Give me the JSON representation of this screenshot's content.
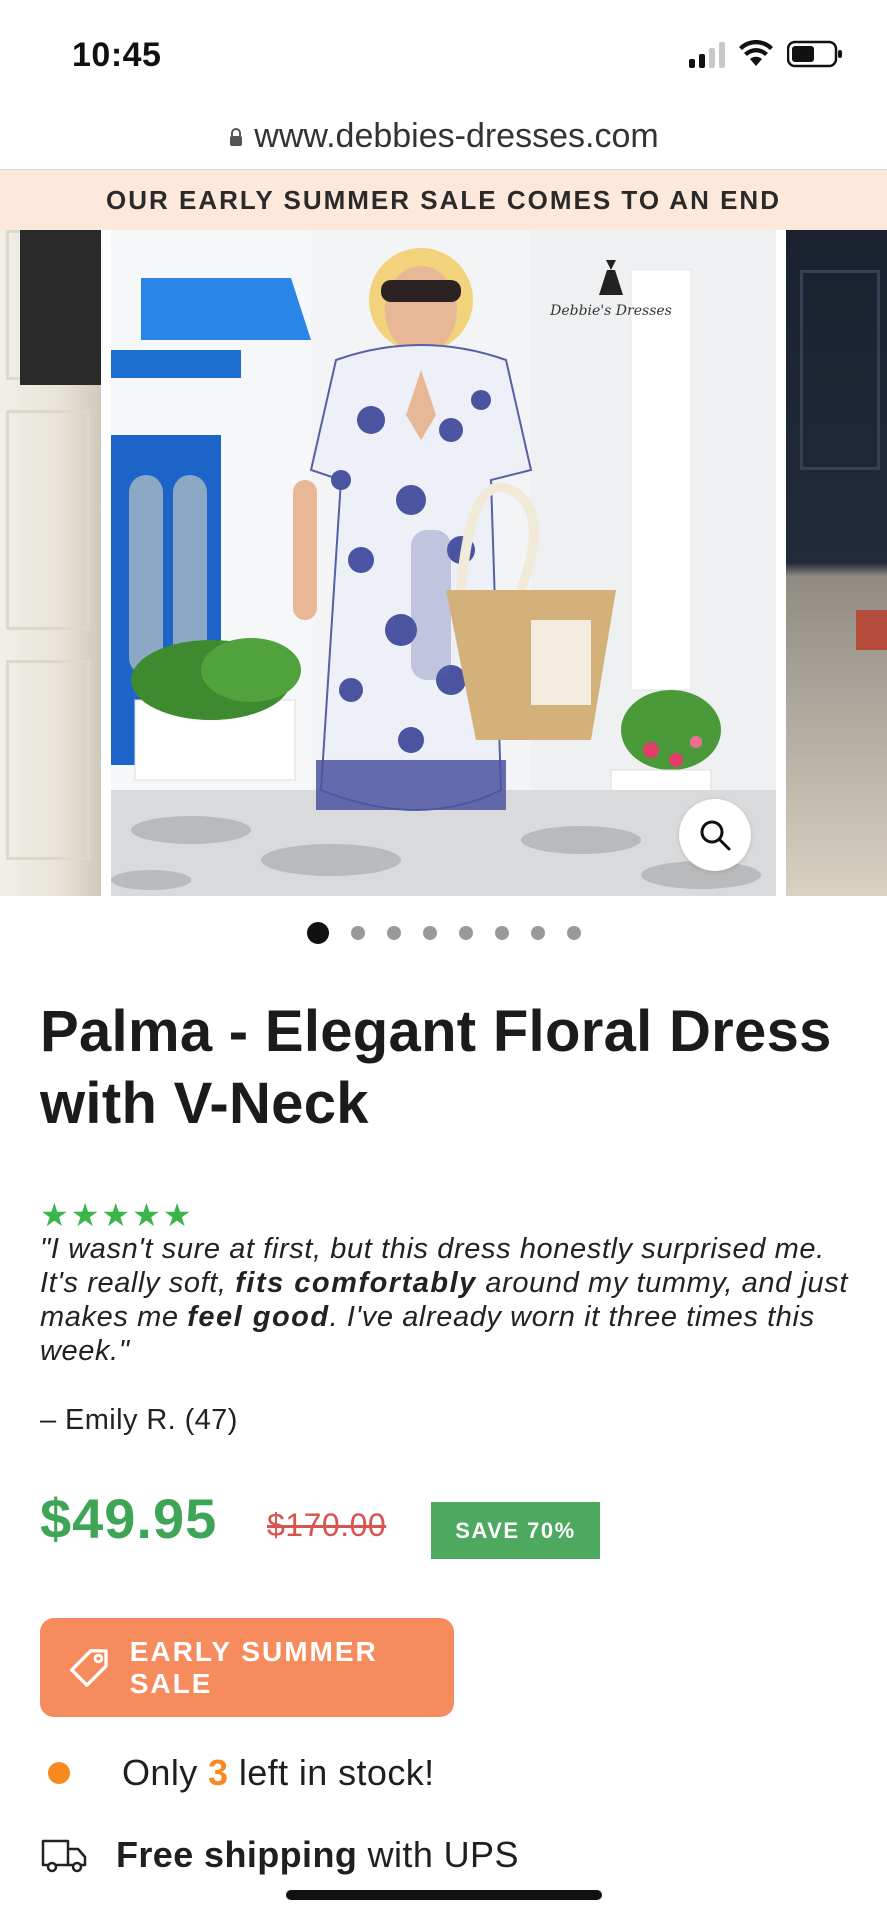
{
  "status_bar": {
    "time": "10:45"
  },
  "browser": {
    "url": "www.debbies-dresses.com"
  },
  "announcement": {
    "text": "OUR EARLY SUMMER SALE COMES TO AN END"
  },
  "gallery": {
    "slide_count": 8,
    "active_index": 0
  },
  "product": {
    "title": "Palma - Elegant Floral Dress with V-Neck",
    "rating_stars": 5,
    "review": {
      "part1": "\"I wasn't sure at first, but this dress honestly surprised me. It's really soft, ",
      "bold1": "fits comfortably",
      "part2": " around my tummy, and just makes me ",
      "bold2": "feel good",
      "part3": ". I've already worn it three times this week.\"",
      "author": "– Emily R. (47)"
    },
    "price": "$49.95",
    "compare_price": "$170.00",
    "save_badge": "SAVE 70%",
    "cta_label": "EARLY SUMMER SALE",
    "stock": {
      "prefix": "Only ",
      "count": "3",
      "suffix": " left in stock!"
    },
    "shipping": {
      "bold": "Free shipping",
      "rest": " with UPS"
    }
  },
  "colors": {
    "accent_green": "#3ea556",
    "sale_orange": "#f68b5e",
    "stock_orange": "#f7891f",
    "strike_red": "#d9534f",
    "announce_bg": "#fde9dc"
  },
  "icons": [
    "lock-icon",
    "wifi-icon",
    "battery-icon",
    "signal-icon",
    "search-icon",
    "tag-icon",
    "truck-icon"
  ]
}
